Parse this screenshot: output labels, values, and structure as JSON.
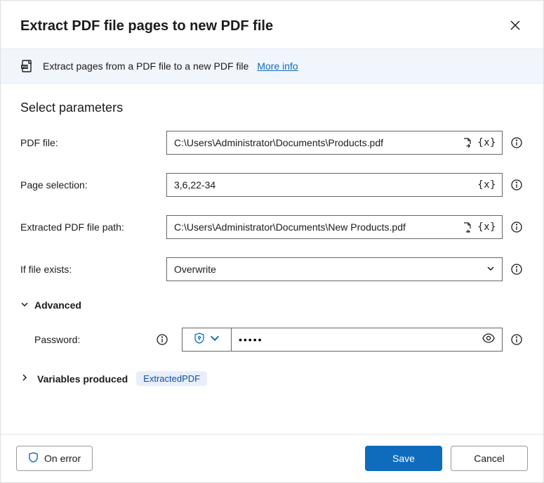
{
  "header": {
    "title": "Extract PDF file pages to new PDF file"
  },
  "info": {
    "icon": "pdf-badge-icon",
    "text": "Extract pages from a PDF file to a new PDF file ",
    "linkText": "More info"
  },
  "section_title": "Select parameters",
  "fields": {
    "pdf_file": {
      "label": "PDF file:",
      "value": "C:\\Users\\Administrator\\Documents\\Products.pdf",
      "has_file_picker": true,
      "has_variable_picker": true
    },
    "page_selection": {
      "label": "Page selection:",
      "value": "3,6,22-34",
      "has_file_picker": false,
      "has_variable_picker": true
    },
    "extracted_path": {
      "label": "Extracted PDF file path:",
      "value": "C:\\Users\\Administrator\\Documents\\New Products.pdf",
      "has_file_picker": true,
      "has_variable_picker": true
    },
    "if_exists": {
      "label": "If file exists:",
      "value": "Overwrite"
    }
  },
  "advanced": {
    "label": "Advanced",
    "password_label": "Password:",
    "password_value": "•••••"
  },
  "variables_produced": {
    "label": "Variables produced",
    "chip": "ExtractedPDF"
  },
  "footer": {
    "on_error": "On error",
    "save": "Save",
    "cancel": "Cancel"
  },
  "variable_token": "{x}"
}
